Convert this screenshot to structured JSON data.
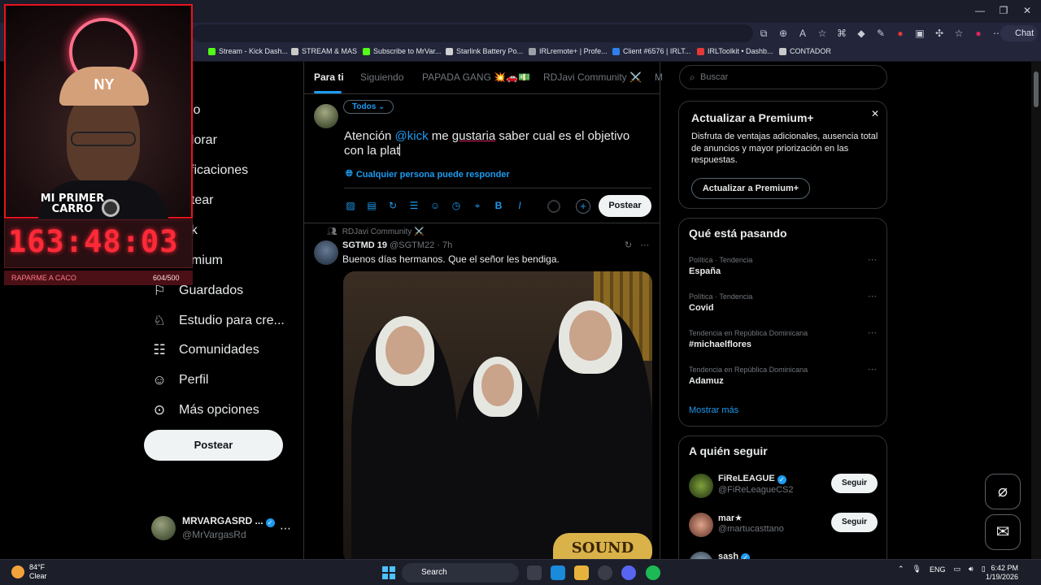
{
  "browser": {
    "chat_label": "Chat",
    "bookmarks": [
      {
        "label": "Stream - Kick Dash...",
        "color": "#53fc18"
      },
      {
        "label": "STREAM & MAS",
        "color": "#c9c9c9"
      },
      {
        "label": "Subscribe to MrVar...",
        "color": "#53fc18"
      },
      {
        "label": "Starlink Battery Po...",
        "color": "#d0d0d0"
      },
      {
        "label": "IRLremote+ | Profe...",
        "color": "#9aa0a6"
      },
      {
        "label": "Client #6576 | IRLT...",
        "color": "#2f80ed"
      },
      {
        "label": "IRLToolkit • Dashb...",
        "color": "#e53935"
      },
      {
        "label": "CONTADOR",
        "color": "#c9c9c9"
      }
    ]
  },
  "nav": {
    "items": [
      {
        "label": "cio",
        "icon": "home-icon"
      },
      {
        "label": "plorar",
        "icon": "search-icon"
      },
      {
        "label": "tificaciones",
        "icon": "bell-icon"
      },
      {
        "label": "atear",
        "icon": "mail-icon"
      },
      {
        "label": "ok",
        "icon": "grok-icon"
      },
      {
        "label": "emium",
        "icon": "x-premium-icon"
      },
      {
        "label": "Guardados",
        "icon": "bookmark-icon"
      },
      {
        "label": "Estudio para cre...",
        "icon": "creator-studio-icon"
      },
      {
        "label": "Comunidades",
        "icon": "communities-icon"
      },
      {
        "label": "Perfil",
        "icon": "person-icon"
      },
      {
        "label": "Más opciones",
        "icon": "more-circle-icon"
      }
    ],
    "post_label": "Postear",
    "account": {
      "name": "MRVARGASRD ...",
      "handle": "@MrVargasRd"
    }
  },
  "tabs": [
    "Para ti",
    "Siguiendo",
    "PAPADA GANG 💥🚗💵",
    "RDJavi Community ⚔️",
    "M"
  ],
  "compose": {
    "audience": "Todos",
    "text_before": "Atención ",
    "mention": "@kick",
    "text_mid": " me ",
    "misspelled": "gustaria",
    "text_after": " saber cual es el objetivo con la plat",
    "reply_setting": "Cualquier persona puede responder",
    "post_label": "Postear"
  },
  "tweet": {
    "context": "RDJavi Community ⚔️",
    "name": "SGTMD 19",
    "handle": "@SGTM22 · 7h",
    "text": "Buenos días hermanos. Que el señor les bendiga.",
    "media_logo": "SOUND"
  },
  "right": {
    "search_placeholder": "Buscar",
    "premium": {
      "title": "Actualizar a Premium+",
      "body": "Disfruta de ventajas adicionales, ausencia total de anuncios y mayor priorización en las respuestas.",
      "button": "Actualizar a Premium+"
    },
    "trends_title": "Qué está pasando",
    "trends": [
      {
        "meta": "Política · Tendencia",
        "topic": "España"
      },
      {
        "meta": "Política · Tendencia",
        "topic": "Covid"
      },
      {
        "meta": "Tendencia en República Dominicana",
        "topic": "#michaelflores"
      },
      {
        "meta": "Tendencia en República Dominicana",
        "topic": "Adamuz"
      }
    ],
    "show_more": "Mostrar más",
    "follow_title": "A quién seguir",
    "follow": [
      {
        "name": "FiReLEAGUE",
        "handle": "@FiReLeagueCS2",
        "button": "Seguir"
      },
      {
        "name": "mar★",
        "handle": "@martucasttano",
        "button": "Seguir"
      },
      {
        "name": "sash",
        "handle": "",
        "button": ""
      }
    ]
  },
  "overlay": {
    "label": "MI PRIMER CARRO",
    "timer": "163:48:03",
    "goal_name": "RAPARME A CACO",
    "goal_count": "604/500",
    "goal_progress": 1.0
  },
  "taskbar": {
    "temp": "84°F",
    "condition": "Clear",
    "search_label": "Search",
    "lang": "ENG",
    "time": "6:42 PM",
    "date": "1/19/2026"
  }
}
